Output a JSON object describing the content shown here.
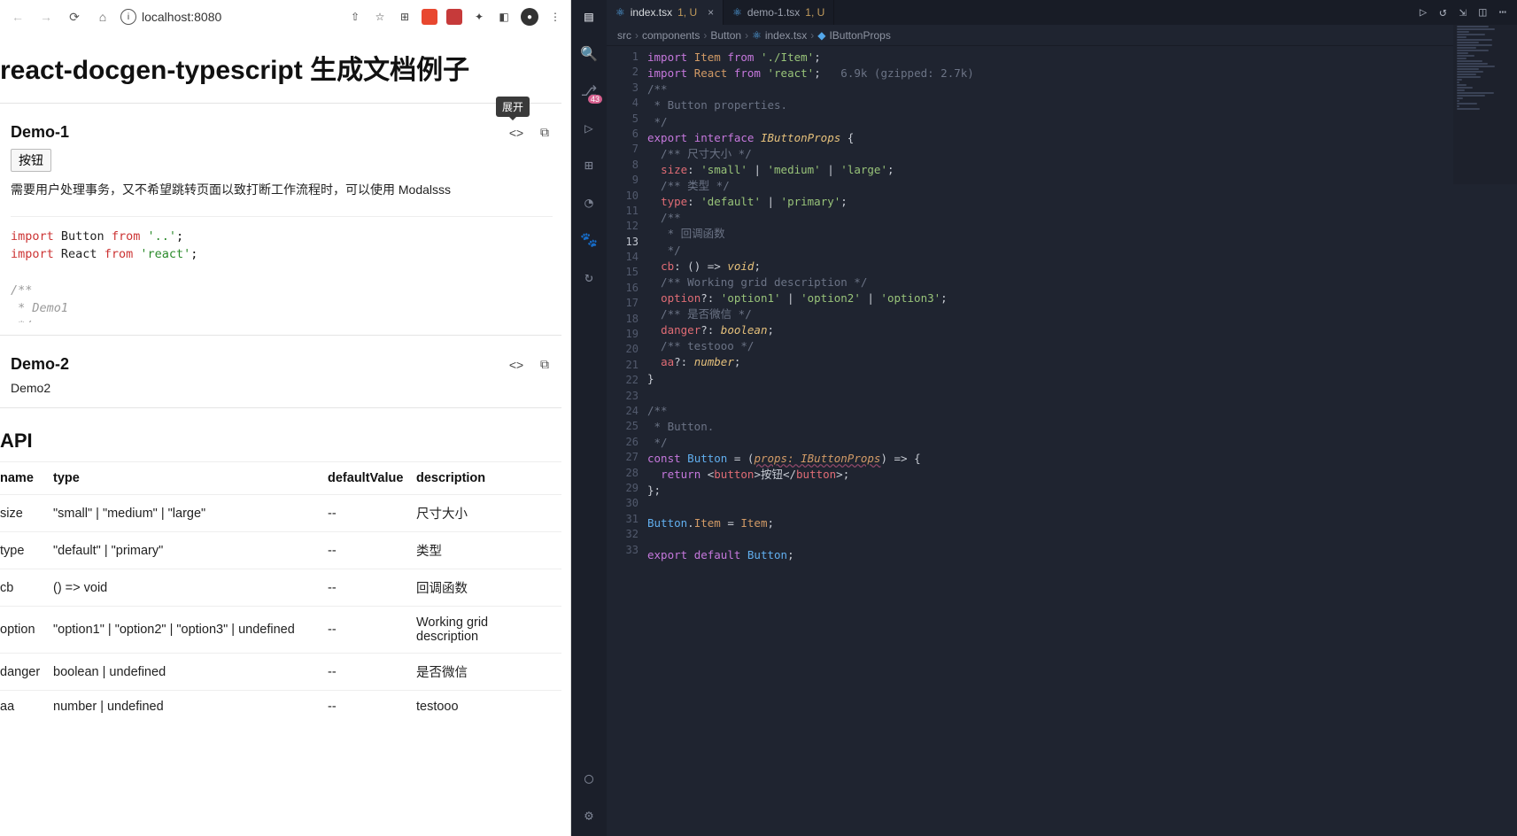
{
  "browser": {
    "url": "localhost:8080",
    "page_title": "react-docgen-typescript 生成文档例子",
    "demos": [
      {
        "title": "Demo-1",
        "button_label": "按钮",
        "description": "需要用户处理事务，又不希望跳转页面以致打断工作流程时，可以使用 Modalsss",
        "tooltip": "展开"
      },
      {
        "title": "Demo-2",
        "body_text": "Demo2"
      }
    ],
    "code_preview": {
      "line1_kw": "import",
      "line1_id": "Button",
      "line1_from": "from",
      "line1_str": "'..'",
      "line2_kw": "import",
      "line2_id": "React",
      "line2_from": "from",
      "line2_str": "'react'",
      "cmt_open": "/**",
      "cmt_body": " * Demo1",
      "cmt_close": " */"
    },
    "api_title": "API",
    "api_headers": [
      "name",
      "type",
      "defaultValue",
      "description"
    ],
    "api_rows": [
      {
        "name": "size",
        "type": "\"small\" | \"medium\" | \"large\"",
        "defaultValue": "--",
        "description": "尺寸大小"
      },
      {
        "name": "type",
        "type": "\"default\" | \"primary\"",
        "defaultValue": "--",
        "description": "类型"
      },
      {
        "name": "cb",
        "type": "() => void",
        "defaultValue": "--",
        "description": "回调函数"
      },
      {
        "name": "option",
        "type": "\"option1\" | \"option2\" | \"option3\" | undefined",
        "defaultValue": "--",
        "description": "Working grid description"
      },
      {
        "name": "danger",
        "type": "boolean | undefined",
        "defaultValue": "--",
        "description": "是否微信"
      },
      {
        "name": "aa",
        "type": "number | undefined",
        "defaultValue": "--",
        "description": "testooo"
      }
    ]
  },
  "vscode": {
    "source_control_badge": "43",
    "tabs": [
      {
        "icon": "⚛",
        "name": "index.tsx",
        "suffix": "1, U",
        "active": true,
        "closable": true
      },
      {
        "icon": "⚛",
        "name": "demo-1.tsx",
        "suffix": "1, U",
        "active": false,
        "closable": false
      }
    ],
    "breadcrumbs": [
      "src",
      "components",
      "Button",
      "index.tsx",
      "IButtonProps"
    ],
    "size_hint": "6.9k (gzipped: 2.7k)",
    "cursor_line": 13,
    "code_lines": [
      {
        "n": 1,
        "tokens": [
          [
            "kw",
            "import"
          ],
          [
            "punc",
            " "
          ],
          [
            "id",
            "Item"
          ],
          [
            "punc",
            " "
          ],
          [
            "kw",
            "from"
          ],
          [
            "punc",
            " "
          ],
          [
            "str",
            "'./Item'"
          ],
          [
            "punc",
            ";"
          ]
        ]
      },
      {
        "n": 2,
        "tokens": [
          [
            "kw",
            "import"
          ],
          [
            "punc",
            " "
          ],
          [
            "id",
            "React"
          ],
          [
            "punc",
            " "
          ],
          [
            "kw",
            "from"
          ],
          [
            "punc",
            " "
          ],
          [
            "str",
            "'react'"
          ],
          [
            "punc",
            ";   "
          ],
          [
            "hint",
            "6.9k (gzipped: 2.7k)"
          ]
        ]
      },
      {
        "n": 3,
        "tokens": [
          [
            "cmt",
            "/**"
          ]
        ]
      },
      {
        "n": 4,
        "tokens": [
          [
            "cmt",
            " * Button properties."
          ]
        ]
      },
      {
        "n": 5,
        "tokens": [
          [
            "cmt",
            " */"
          ]
        ]
      },
      {
        "n": 6,
        "tokens": [
          [
            "kw",
            "export"
          ],
          [
            "punc",
            " "
          ],
          [
            "kw",
            "interface"
          ],
          [
            "punc",
            " "
          ],
          [
            "type",
            "IButtonProps"
          ],
          [
            "punc",
            " {"
          ]
        ]
      },
      {
        "n": 7,
        "tokens": [
          [
            "cmt",
            "  /** 尺寸大小 */"
          ]
        ]
      },
      {
        "n": 8,
        "tokens": [
          [
            "punc",
            "  "
          ],
          [
            "prop",
            "size"
          ],
          [
            "punc",
            ": "
          ],
          [
            "str",
            "'small'"
          ],
          [
            "punc",
            " | "
          ],
          [
            "str",
            "'medium'"
          ],
          [
            "punc",
            " | "
          ],
          [
            "str",
            "'large'"
          ],
          [
            "punc",
            ";"
          ]
        ]
      },
      {
        "n": 9,
        "tokens": [
          [
            "cmt",
            "  /** 类型 */"
          ]
        ]
      },
      {
        "n": 10,
        "tokens": [
          [
            "punc",
            "  "
          ],
          [
            "prop",
            "type"
          ],
          [
            "punc",
            ": "
          ],
          [
            "str",
            "'default'"
          ],
          [
            "punc",
            " | "
          ],
          [
            "str",
            "'primary'"
          ],
          [
            "punc",
            ";"
          ]
        ]
      },
      {
        "n": 11,
        "tokens": [
          [
            "cmt",
            "  /**"
          ]
        ]
      },
      {
        "n": 12,
        "tokens": [
          [
            "cmt",
            "   * 回调函数"
          ]
        ]
      },
      {
        "n": 13,
        "tokens": [
          [
            "cmt",
            "   */"
          ]
        ]
      },
      {
        "n": 14,
        "tokens": [
          [
            "punc",
            "  "
          ],
          [
            "prop",
            "cb"
          ],
          [
            "punc",
            ": () => "
          ],
          [
            "type",
            "void"
          ],
          [
            "punc",
            ";"
          ]
        ]
      },
      {
        "n": 15,
        "tokens": [
          [
            "cmt",
            "  /** Working grid description */"
          ]
        ]
      },
      {
        "n": 16,
        "tokens": [
          [
            "punc",
            "  "
          ],
          [
            "prop",
            "option"
          ],
          [
            "punc",
            "?: "
          ],
          [
            "str",
            "'option1'"
          ],
          [
            "punc",
            " | "
          ],
          [
            "str",
            "'option2'"
          ],
          [
            "punc",
            " | "
          ],
          [
            "str",
            "'option3'"
          ],
          [
            "punc",
            ";"
          ]
        ]
      },
      {
        "n": 17,
        "tokens": [
          [
            "cmt",
            "  /** 是否微信 */"
          ]
        ]
      },
      {
        "n": 18,
        "tokens": [
          [
            "punc",
            "  "
          ],
          [
            "prop",
            "danger"
          ],
          [
            "punc",
            "?: "
          ],
          [
            "type",
            "boolean"
          ],
          [
            "punc",
            ";"
          ]
        ]
      },
      {
        "n": 19,
        "tokens": [
          [
            "cmt",
            "  /** testooo */"
          ]
        ]
      },
      {
        "n": 20,
        "tokens": [
          [
            "punc",
            "  "
          ],
          [
            "prop",
            "aa"
          ],
          [
            "punc",
            "?: "
          ],
          [
            "type",
            "number"
          ],
          [
            "punc",
            ";"
          ]
        ]
      },
      {
        "n": 21,
        "tokens": [
          [
            "punc",
            "}"
          ]
        ]
      },
      {
        "n": 22,
        "tokens": [
          [
            "punc",
            " "
          ]
        ]
      },
      {
        "n": 23,
        "tokens": [
          [
            "cmt",
            "/**"
          ]
        ]
      },
      {
        "n": 24,
        "tokens": [
          [
            "cmt",
            " * Button."
          ]
        ]
      },
      {
        "n": 25,
        "tokens": [
          [
            "cmt",
            " */"
          ]
        ]
      },
      {
        "n": 26,
        "tokens": [
          [
            "kw",
            "const"
          ],
          [
            "punc",
            " "
          ],
          [
            "fn",
            "Button"
          ],
          [
            "punc",
            " = ("
          ],
          [
            "param",
            "props: IButtonProps"
          ],
          [
            "punc",
            ") => {"
          ]
        ]
      },
      {
        "n": 27,
        "tokens": [
          [
            "punc",
            "  "
          ],
          [
            "kw",
            "return"
          ],
          [
            "punc",
            " <"
          ],
          [
            "tag",
            "button"
          ],
          [
            "punc",
            ">按钮</"
          ],
          [
            "tag",
            "button"
          ],
          [
            "punc",
            ">;"
          ]
        ]
      },
      {
        "n": 28,
        "tokens": [
          [
            "punc",
            "};"
          ]
        ]
      },
      {
        "n": 29,
        "tokens": [
          [
            "punc",
            " "
          ]
        ]
      },
      {
        "n": 30,
        "tokens": [
          [
            "fn",
            "Button"
          ],
          [
            "punc",
            "."
          ],
          [
            "id",
            "Item"
          ],
          [
            "punc",
            " = "
          ],
          [
            "id",
            "Item"
          ],
          [
            "punc",
            ";"
          ]
        ]
      },
      {
        "n": 31,
        "tokens": [
          [
            "punc",
            " "
          ]
        ]
      },
      {
        "n": 32,
        "tokens": [
          [
            "kw",
            "export"
          ],
          [
            "punc",
            " "
          ],
          [
            "kw",
            "default"
          ],
          [
            "punc",
            " "
          ],
          [
            "fn",
            "Button"
          ],
          [
            "punc",
            ";"
          ]
        ]
      },
      {
        "n": 33,
        "tokens": [
          [
            "punc",
            " "
          ]
        ]
      }
    ]
  }
}
